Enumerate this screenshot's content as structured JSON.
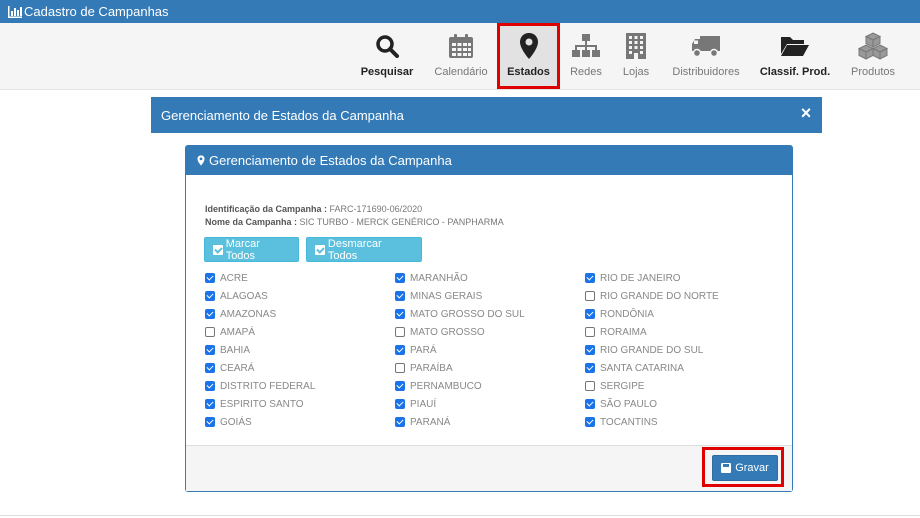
{
  "app": {
    "title": "Cadastro de Campanhas"
  },
  "toolbar": {
    "items": [
      {
        "label": "Pesquisar",
        "icon": "search-icon"
      },
      {
        "label": "Calendário",
        "icon": "calendar-icon"
      },
      {
        "label": "Estados",
        "icon": "map-marker-icon"
      },
      {
        "label": "Redes",
        "icon": "sitemap-icon"
      },
      {
        "label": "Lojas",
        "icon": "building-icon"
      },
      {
        "label": "Distribuidores",
        "icon": "truck-icon"
      },
      {
        "label": "Classif. Prod.",
        "icon": "folder-open-icon"
      },
      {
        "label": "Produtos",
        "icon": "cubes-icon"
      }
    ]
  },
  "modal": {
    "title": "Gerenciamento de Estados da Campanha",
    "close_label": "×"
  },
  "panel": {
    "title": "Gerenciamento de Estados da Campanha",
    "id_label": "Identificação da Campanha :",
    "id_value": "FARC-171690-06/2020",
    "name_label": "Nome da Campanha :",
    "name_value": "SIC TURBO - MERCK GENÉRICO - PANPHARMA",
    "mark_all": "Marcar Todos",
    "unmark_all": "Desmarcar Todos",
    "save": "Gravar"
  },
  "states": [
    [
      {
        "name": "ACRE",
        "checked": true
      },
      {
        "name": "ALAGOAS",
        "checked": true
      },
      {
        "name": "AMAZONAS",
        "checked": true
      },
      {
        "name": "AMAPÁ",
        "checked": false
      },
      {
        "name": "BAHIA",
        "checked": true
      },
      {
        "name": "CEARÁ",
        "checked": true
      },
      {
        "name": "DISTRITO FEDERAL",
        "checked": true
      },
      {
        "name": "ESPIRITO SANTO",
        "checked": true
      },
      {
        "name": "GOIÁS",
        "checked": true
      }
    ],
    [
      {
        "name": "MARANHÃO",
        "checked": true
      },
      {
        "name": "MINAS GERAIS",
        "checked": true
      },
      {
        "name": "MATO GROSSO DO SUL",
        "checked": true
      },
      {
        "name": "MATO GROSSO",
        "checked": false
      },
      {
        "name": "PARÁ",
        "checked": true
      },
      {
        "name": "PARAÍBA",
        "checked": false
      },
      {
        "name": "PERNAMBUCO",
        "checked": true
      },
      {
        "name": "PIAUÍ",
        "checked": true
      },
      {
        "name": "PARANÁ",
        "checked": true
      }
    ],
    [
      {
        "name": "RIO DE JANEIRO",
        "checked": true
      },
      {
        "name": "RIO GRANDE DO NORTE",
        "checked": false
      },
      {
        "name": "RONDÔNIA",
        "checked": true
      },
      {
        "name": "RORAIMA",
        "checked": false
      },
      {
        "name": "RIO GRANDE DO SUL",
        "checked": true
      },
      {
        "name": "SANTA CATARINA",
        "checked": true
      },
      {
        "name": "SERGIPE",
        "checked": false
      },
      {
        "name": "SÃO PAULO",
        "checked": true
      },
      {
        "name": "TOCANTINS",
        "checked": true
      }
    ]
  ]
}
